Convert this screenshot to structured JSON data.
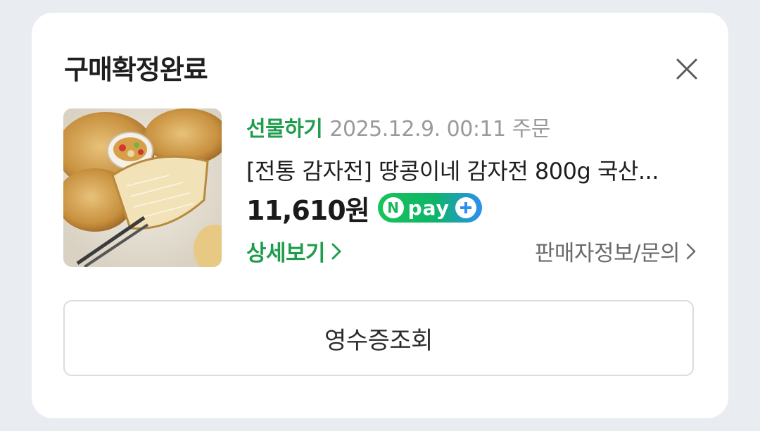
{
  "card": {
    "title": "구매확정완료",
    "close_icon": "close-icon"
  },
  "order": {
    "gift_label": "선물하기",
    "order_date": "2025.12.9. 00:11 주문",
    "product_name": "[전통 감자전] 땅콩이네 감자전 800g 국산...",
    "price": "11,610원",
    "npay": {
      "n_letter": "N",
      "label": "pay"
    },
    "detail_label": "상세보기",
    "seller_label": "판매자정보/문의"
  },
  "actions": {
    "receipt_label": "영수증조회"
  },
  "colors": {
    "accent_green": "#1f9d4c",
    "background": "#e9ecf0",
    "card": "#ffffff",
    "muted_text": "#9a9a9a"
  }
}
